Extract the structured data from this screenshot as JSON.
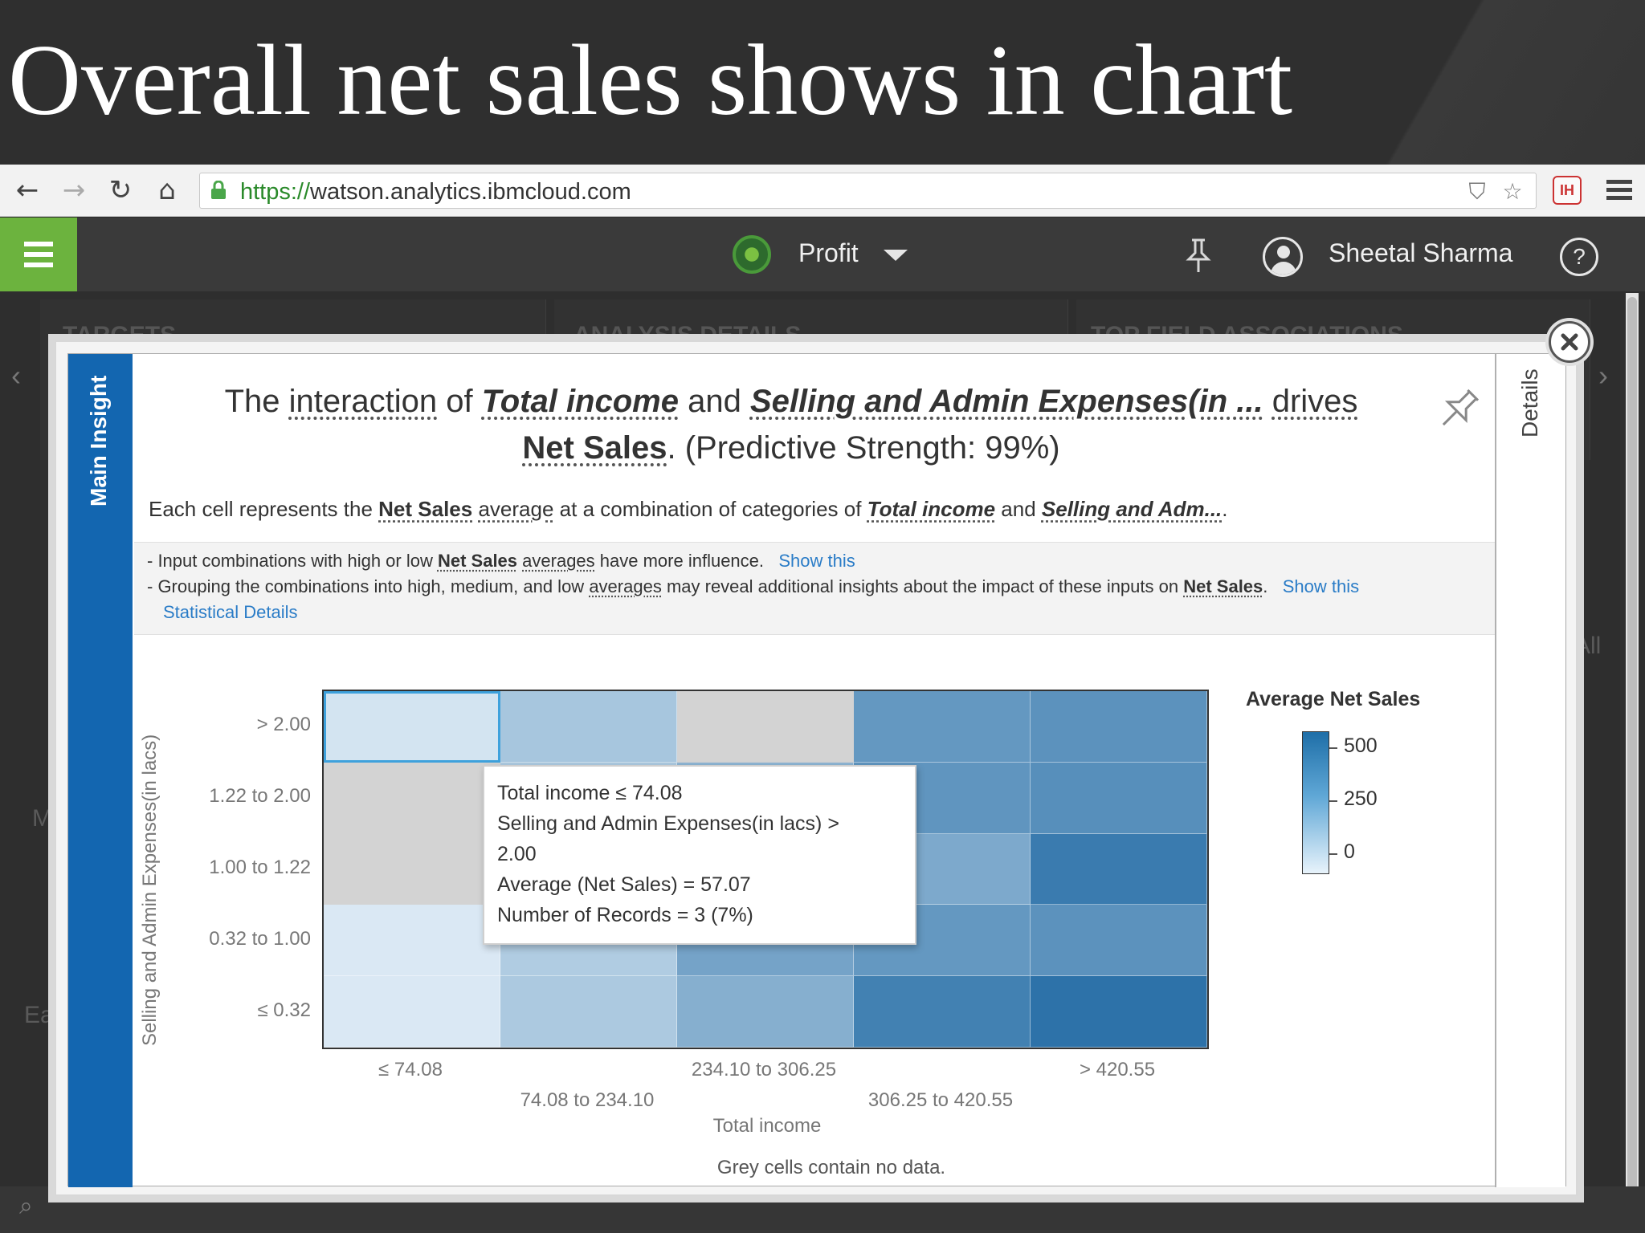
{
  "slide": {
    "title": "Overall net sales shows in chart"
  },
  "browser": {
    "url_scheme": "https://",
    "url_host": "watson.analytics.ibmcloud.com"
  },
  "app": {
    "project_label": "Profit",
    "user_name": "Sheetal Sharma",
    "help_label": "?"
  },
  "background": {
    "panels": [
      "TARGETS",
      "ANALYSIS DETAILS",
      "TOP FIELD ASSOCIATIONS"
    ],
    "fragments": [
      "M",
      "Ea",
      "All"
    ]
  },
  "modal": {
    "main_tab_label": "Main Insight",
    "details_tab_label": "Details",
    "headline": {
      "p1": "The ",
      "interaction": "interaction",
      "p2": " of ",
      "field1": "Total income",
      "p3": " and ",
      "field2": "Selling and Admin Expenses(in ...",
      "p4": " ",
      "drives": "drives",
      "target": "Net Sales",
      "p5": ". (Predictive Strength: 99%)"
    },
    "description": {
      "p1": "Each cell represents the ",
      "target": "Net Sales",
      "p2": " ",
      "average": "average",
      "p3": " at a combination of categories of ",
      "field1": "Total income",
      "p4": " and ",
      "field2": "Selling and Adm...",
      "p5": "."
    },
    "insights": {
      "line1": {
        "p1": "- Input combinations with high or low ",
        "target": "Net Sales",
        "p2": " ",
        "averages": "averages",
        "p3": " have more influence.",
        "link": "Show this"
      },
      "line2": {
        "p1": "- Grouping the combinations into high, medium, and low ",
        "averages": "averages",
        "p2": " may reveal additional insights about the impact of these inputs on ",
        "target": "Net Sales",
        "p3": ".",
        "link": "Show this"
      },
      "stat_link": "Statistical Details"
    },
    "chart_data": {
      "type": "heatmap",
      "xlabel": "Total income",
      "ylabel": "Selling and Admin Expenses(in lacs)",
      "x_categories": [
        "≤ 74.08",
        "74.08 to 234.10",
        "234.10 to 306.25",
        "306.25 to 420.55",
        "> 420.55"
      ],
      "y_categories": [
        "> 2.00",
        "1.22 to 2.00",
        "1.00 to 1.22",
        "0.32 to 1.00",
        "≤ 0.32"
      ],
      "values": [
        [
          57,
          160,
          null,
          320,
          340
        ],
        [
          null,
          150,
          220,
          330,
          350
        ],
        [
          null,
          160,
          240,
          260,
          420
        ],
        [
          40,
          140,
          280,
          320,
          340
        ],
        [
          40,
          150,
          240,
          400,
          450
        ]
      ],
      "legend_title": "Average Net Sales",
      "legend_ticks": [
        "500",
        "250",
        "0"
      ],
      "note": "Grey cells contain no data.",
      "tooltip": [
        "Total income ≤ 74.08",
        "Selling and Admin Expenses(in lacs) >",
        "2.00",
        "Average (Net Sales) = 57.07",
        "Number of Records = 3 (7%)"
      ]
    }
  }
}
